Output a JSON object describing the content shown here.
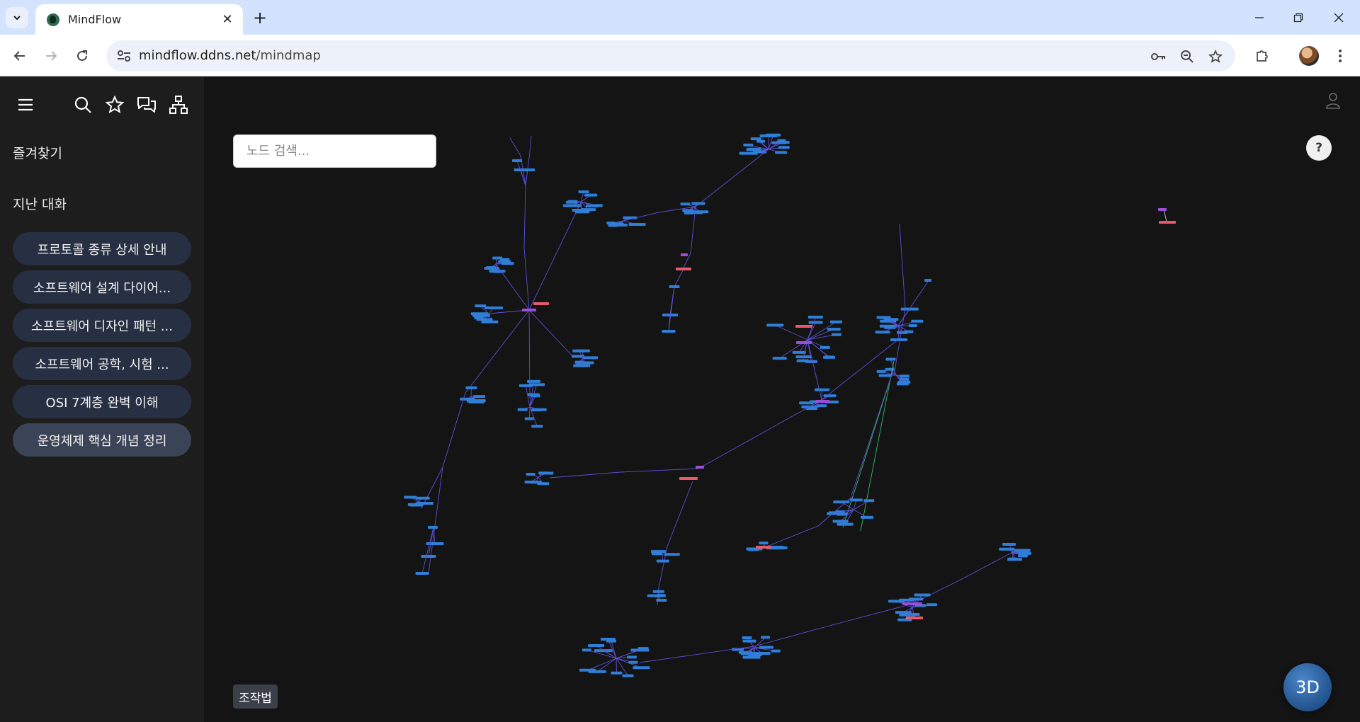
{
  "browser": {
    "tab_title": "MindFlow",
    "tab_close": "✕",
    "new_tab": "+",
    "url_domain": "mindflow.ddns.net",
    "url_path": "/mindmap"
  },
  "sidebar": {
    "favorites_heading": "즐겨찾기",
    "past_conversations_heading": "지난 대화",
    "conversations": [
      {
        "label": "프로토콜 종류 상세 안내"
      },
      {
        "label": "소프트웨어 설계 다이어..."
      },
      {
        "label": "소프트웨어 디자인 패턴 ..."
      },
      {
        "label": "소프트웨어 공학, 시험 ..."
      },
      {
        "label": "OSI 7계층 완벽 이해"
      },
      {
        "label": "운영체제 핵심 개념 정리"
      }
    ],
    "active_index": 5
  },
  "main": {
    "search_placeholder": "노드 검색...",
    "help_label": "?",
    "controls_label": "조작법",
    "view_3d_label": "3D"
  },
  "colors": {
    "edge": "#5b4fd6",
    "edge_green": "#2fbf6a",
    "node": "#2f7fd8",
    "node_root": "#e85a6a",
    "node_accent": "#9b4fd8",
    "background": "#141414"
  }
}
